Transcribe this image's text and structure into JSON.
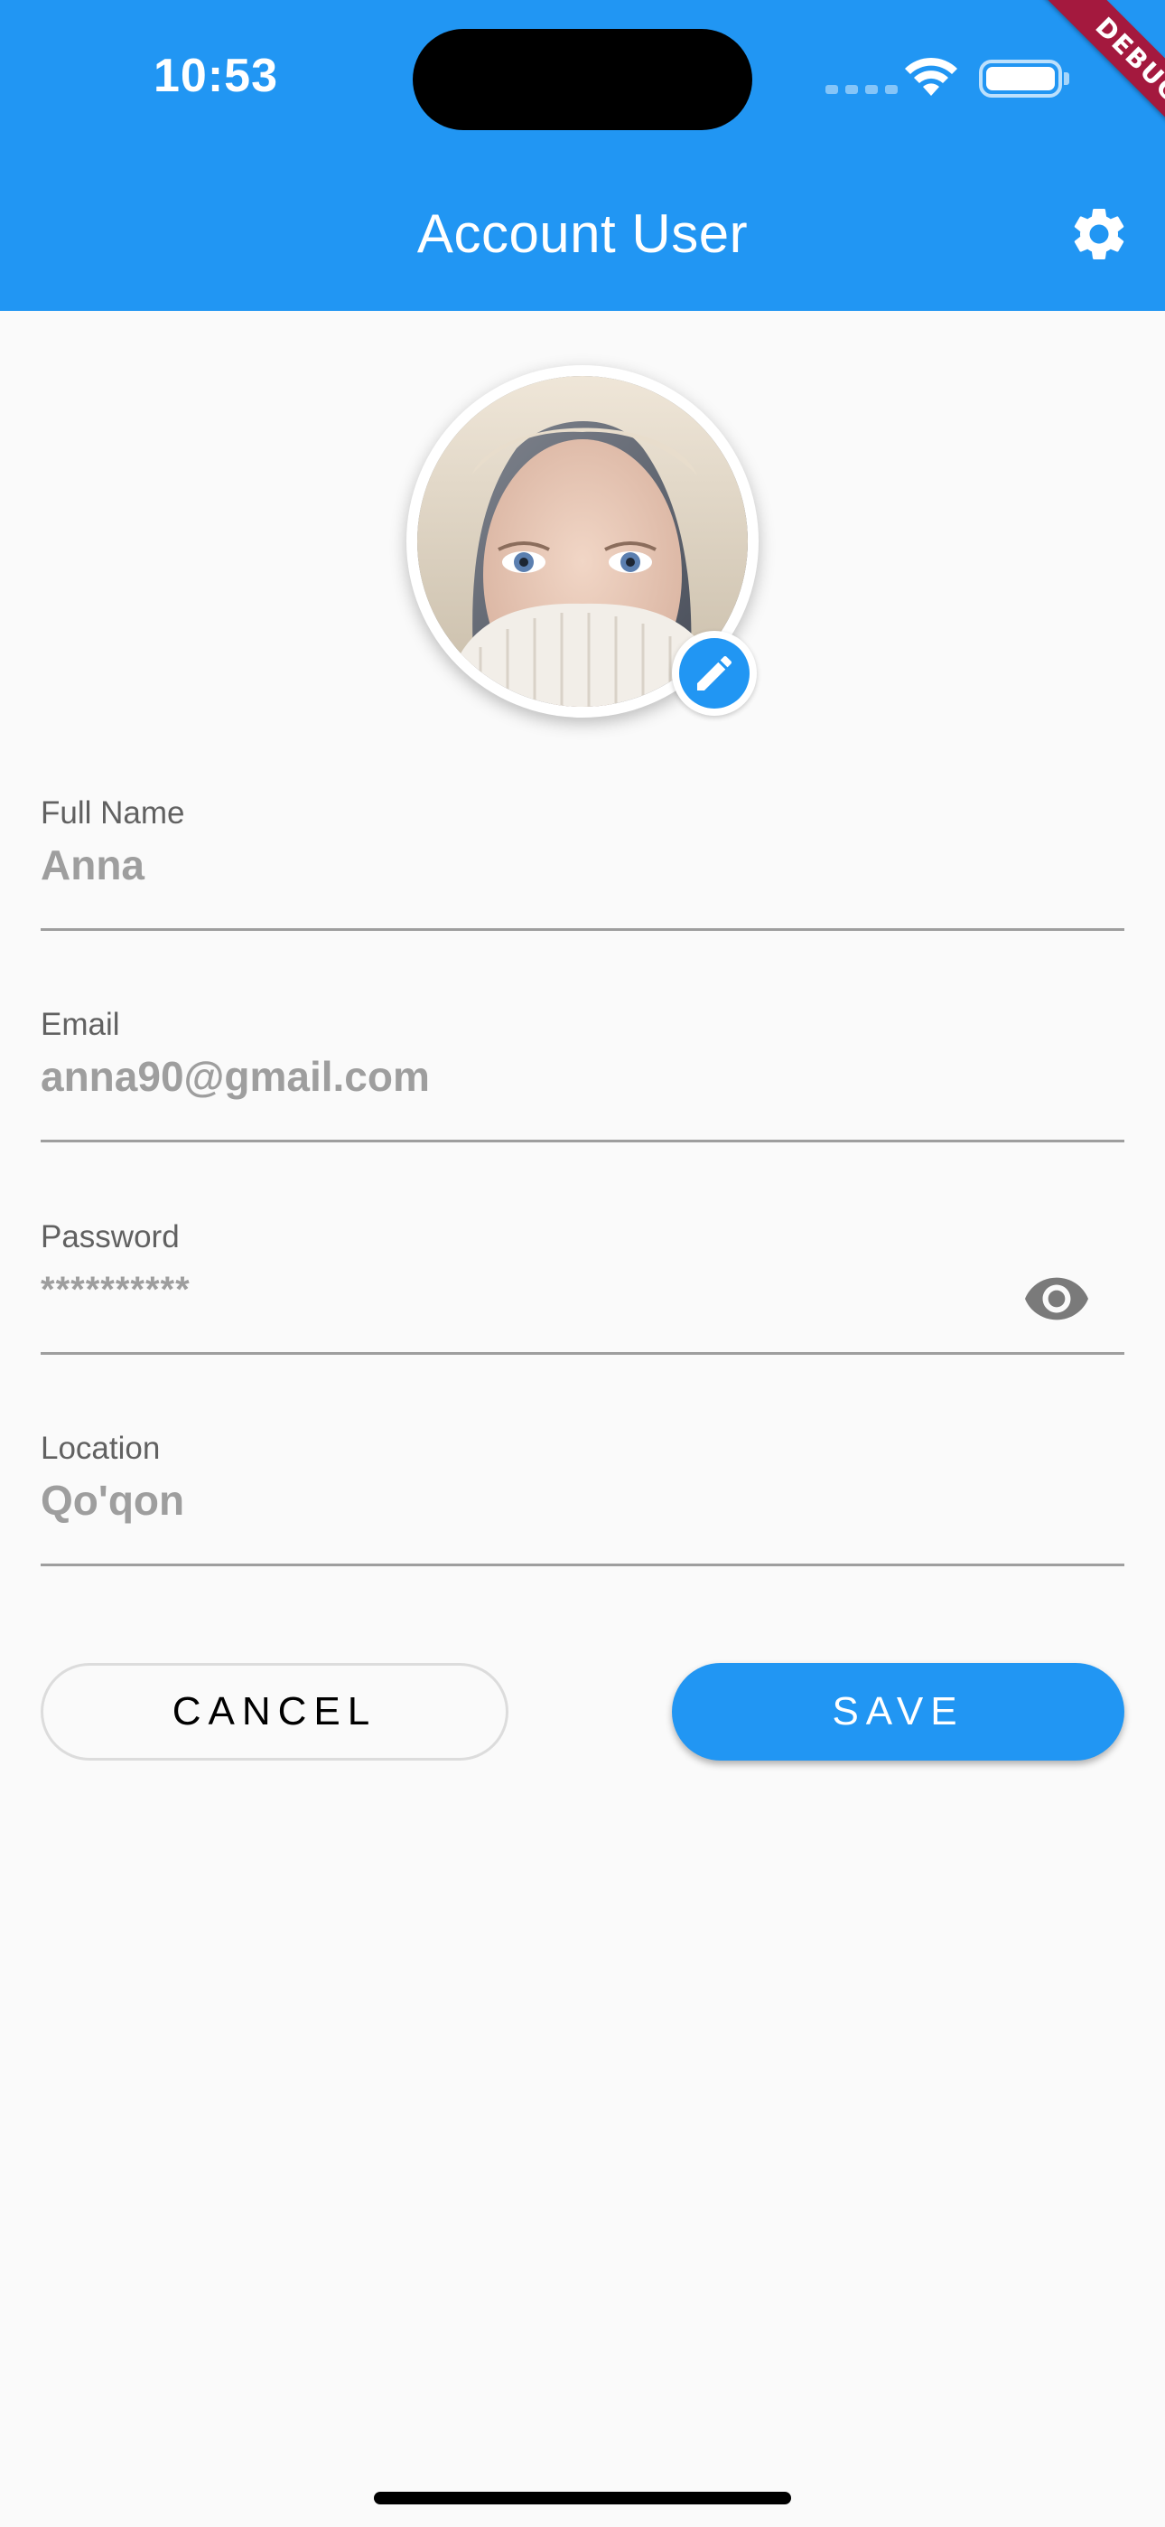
{
  "status_bar": {
    "time": "10:53"
  },
  "debug_banner": "DEBUG",
  "app_bar": {
    "title": "Account User",
    "settings_icon": "gear-icon"
  },
  "profile": {
    "avatar_icon": "profile-photo",
    "edit_icon": "pencil-icon"
  },
  "form": {
    "full_name": {
      "label": "Full Name",
      "value": "Anna"
    },
    "email": {
      "label": "Email",
      "value": "anna90@gmail.com"
    },
    "password": {
      "label": "Password",
      "value": "**********",
      "toggle_icon": "eye-icon"
    },
    "location": {
      "label": "Location",
      "value": "Qo'qon"
    }
  },
  "actions": {
    "cancel_label": "CANCEL",
    "save_label": "SAVE"
  },
  "colors": {
    "primary": "#2196f3",
    "background": "#fafafa",
    "hint_text": "#9e9e9e",
    "debug_banner": "#a4193e"
  }
}
